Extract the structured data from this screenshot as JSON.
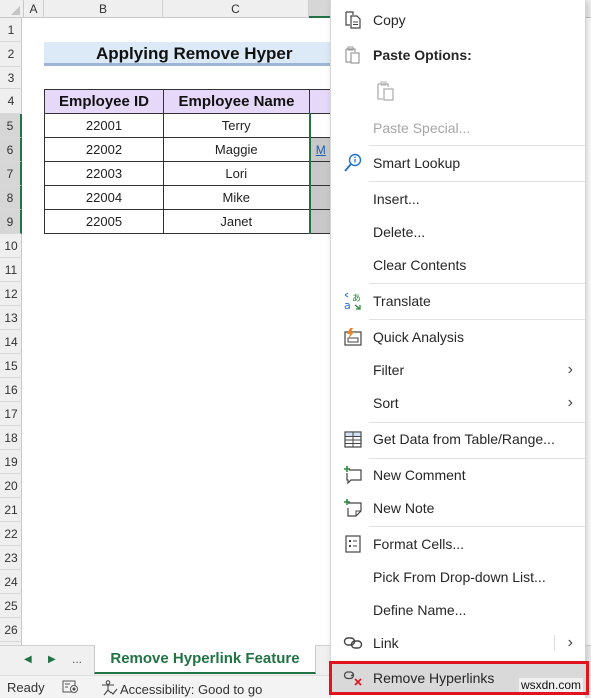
{
  "grid": {
    "corner": "",
    "columns": [
      {
        "label": "A",
        "selected": false
      },
      {
        "label": "B",
        "selected": false
      },
      {
        "label": "C",
        "selected": false
      },
      {
        "label": "",
        "selected": true
      }
    ],
    "rows": [
      "1",
      "2",
      "3",
      "4",
      "5",
      "6",
      "7",
      "8",
      "9",
      "10",
      "11",
      "12",
      "13",
      "14",
      "15",
      "16",
      "17",
      "18",
      "19",
      "20",
      "21",
      "22",
      "23",
      "24",
      "25",
      "26"
    ],
    "selected_rows": [
      "5",
      "6",
      "7",
      "8",
      "9"
    ],
    "title": "Applying Remove Hyper",
    "table": {
      "headers": [
        "Employee ID",
        "Employee Name",
        ""
      ],
      "rows": [
        {
          "id": "22001",
          "name": "Terry",
          "link": ""
        },
        {
          "id": "22002",
          "name": "Maggie",
          "link": "M"
        },
        {
          "id": "22003",
          "name": "Lori",
          "link": ""
        },
        {
          "id": "22004",
          "name": "Mike",
          "link": ""
        },
        {
          "id": "22005",
          "name": "Janet",
          "link": ""
        }
      ]
    }
  },
  "tabs": {
    "prev": "◀",
    "next": "▶",
    "more": "...",
    "active_sheet": "Remove Hyperlink Feature"
  },
  "status": {
    "ready": "Ready",
    "accessibility": "Accessibility: Good to go"
  },
  "context_menu": {
    "items": [
      {
        "key": "copy",
        "label": "Copy",
        "icon": "copy-icon",
        "enabled": true
      },
      {
        "key": "paste_options",
        "label": "Paste Options:",
        "icon": "paste-icon",
        "enabled": true
      },
      {
        "key": "paste_special",
        "label": "Paste Special...",
        "icon": "",
        "enabled": false
      },
      {
        "key": "smart_lookup",
        "label": "Smart Lookup",
        "icon": "smart-lookup-icon",
        "enabled": true
      },
      {
        "key": "insert",
        "label": "Insert...",
        "icon": "",
        "enabled": true
      },
      {
        "key": "delete",
        "label": "Delete...",
        "icon": "",
        "enabled": true
      },
      {
        "key": "clear_contents",
        "label": "Clear Contents",
        "icon": "",
        "enabled": true
      },
      {
        "key": "translate",
        "label": "Translate",
        "icon": "translate-icon",
        "enabled": true
      },
      {
        "key": "quick_analysis",
        "label": "Quick Analysis",
        "icon": "quick-analysis-icon",
        "enabled": true
      },
      {
        "key": "filter",
        "label": "Filter",
        "icon": "",
        "enabled": true,
        "submenu": true
      },
      {
        "key": "sort",
        "label": "Sort",
        "icon": "",
        "enabled": true,
        "submenu": true
      },
      {
        "key": "get_data",
        "label": "Get Data from Table/Range...",
        "icon": "table-icon",
        "enabled": true
      },
      {
        "key": "new_comment",
        "label": "New Comment",
        "icon": "new-comment-icon",
        "enabled": true
      },
      {
        "key": "new_note",
        "label": "New Note",
        "icon": "new-note-icon",
        "enabled": true
      },
      {
        "key": "format_cells",
        "label": "Format Cells...",
        "icon": "format-cells-icon",
        "enabled": true
      },
      {
        "key": "pick_list",
        "label": "Pick From Drop-down List...",
        "icon": "",
        "enabled": true
      },
      {
        "key": "define_name",
        "label": "Define Name...",
        "icon": "",
        "enabled": true
      },
      {
        "key": "link",
        "label": "Link",
        "icon": "link-icon",
        "enabled": true,
        "submenu": true
      },
      {
        "key": "remove_hyperlinks",
        "label": "Remove Hyperlinks",
        "icon": "remove-link-icon",
        "enabled": true,
        "highlighted": true
      }
    ],
    "chevron": "›"
  },
  "colors": {
    "excel_green": "#217346",
    "header_purple": "#e6d8f8",
    "title_blue": "#dce9f6",
    "highlight_red": "#e0141e",
    "link_blue": "#1f5fae"
  },
  "watermark": "wsxdn.com"
}
